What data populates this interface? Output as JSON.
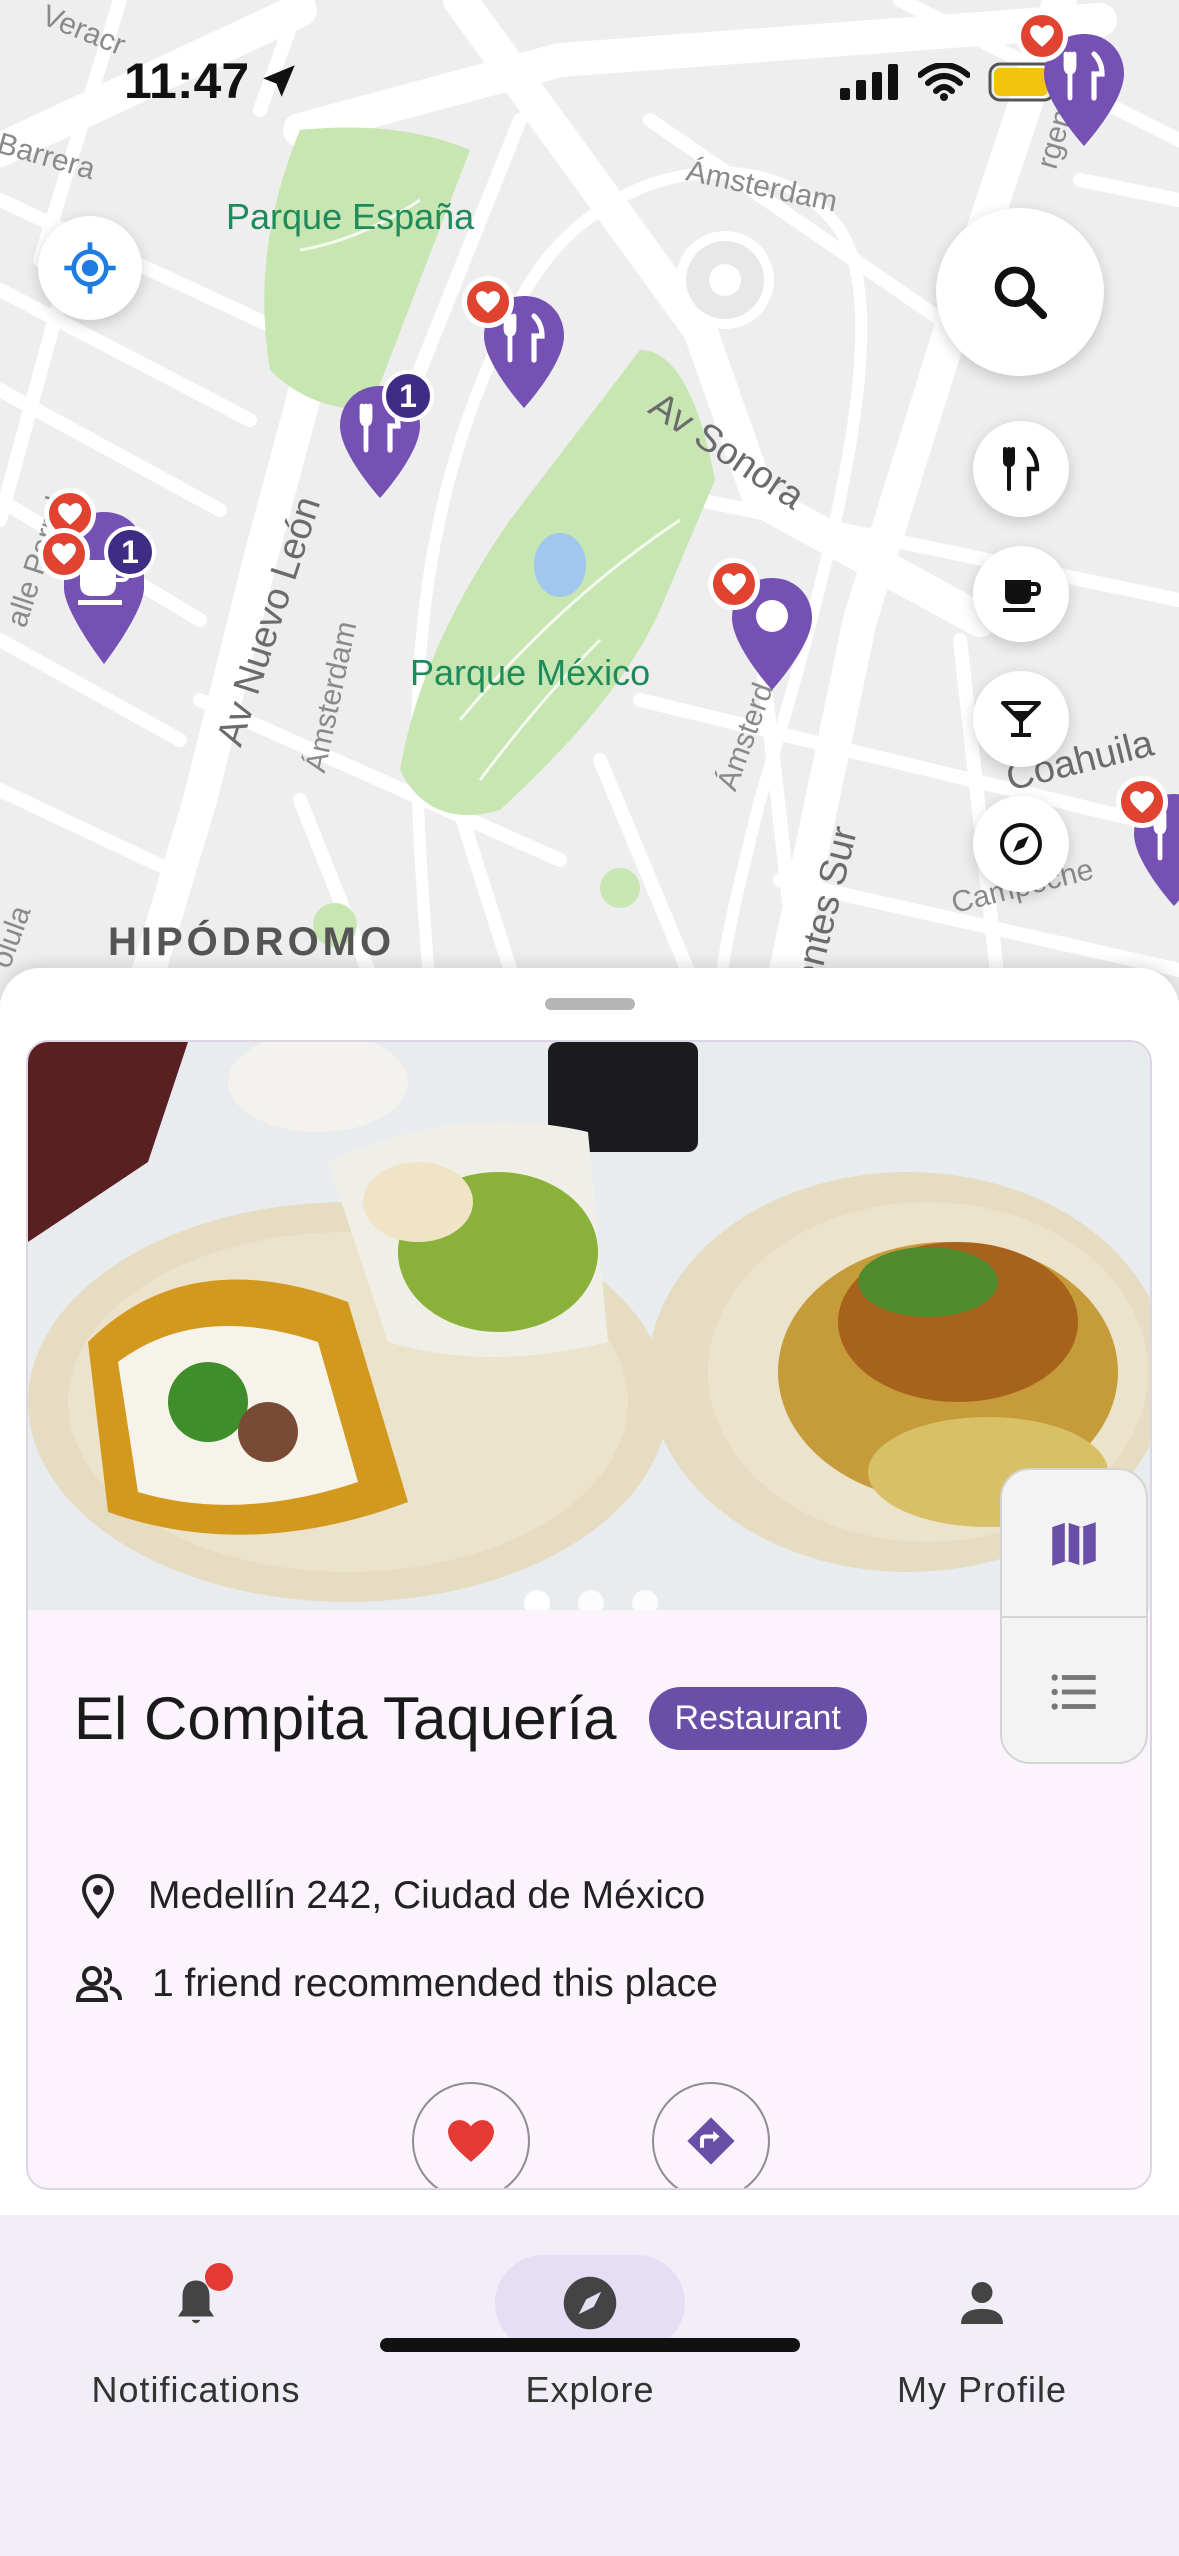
{
  "status_bar": {
    "time": "11:47"
  },
  "map": {
    "labels": {
      "parque_espana": "Parque España",
      "parque_mexico": "Parque México",
      "amsterdam_top": "Ámsterdam",
      "av_sonora": "Av Sonora",
      "av_nuevo_leon": "Av Nuevo León",
      "amsterdam_left": "Ámsterdam",
      "amsterdam_right": "Ámsterd",
      "coahuila": "Coahuila",
      "campeche": "Campeche",
      "hipodromo": "HIPÓDROMO",
      "barrera": "Barrera",
      "veracruz": "Veracr",
      "calle_parral": "alle Parral",
      "insurgentes": "entes Sur",
      "argentina": "rgenti",
      "oluia": "olula"
    },
    "pins": [
      {
        "name": "restaurant-pin",
        "icon": "fork-knife-icon",
        "favorite": true,
        "count": ""
      },
      {
        "name": "restaurant-pin",
        "icon": "fork-knife-icon",
        "favorite": false,
        "count": "1"
      },
      {
        "name": "cafe-pin",
        "icon": "cup-icon",
        "favorite": true,
        "count": "1"
      },
      {
        "name": "selected-place-pin",
        "icon": "location-dot-icon",
        "favorite": true,
        "count": ""
      }
    ],
    "filters": [
      "fork-knife-icon",
      "cup-icon",
      "cocktail-icon",
      "compass-icon"
    ]
  },
  "place": {
    "name": "El Compita Taquería",
    "category": "Restaurant",
    "address": "Medellín 242, Ciudad de México",
    "friends_text": "1 friend recommended this place",
    "photo_count": 3,
    "active_photo": 1
  },
  "nav": {
    "items": [
      {
        "label": "Notifications",
        "icon": "bell-icon"
      },
      {
        "label": "Explore",
        "icon": "compass-icon"
      },
      {
        "label": "My Profile",
        "icon": "person-icon"
      }
    ],
    "active": "Explore"
  },
  "colors": {
    "accent": "#6a4fa8",
    "pin": "#7451b3",
    "heart": "#e0432f",
    "park": "#c8e6b1"
  }
}
